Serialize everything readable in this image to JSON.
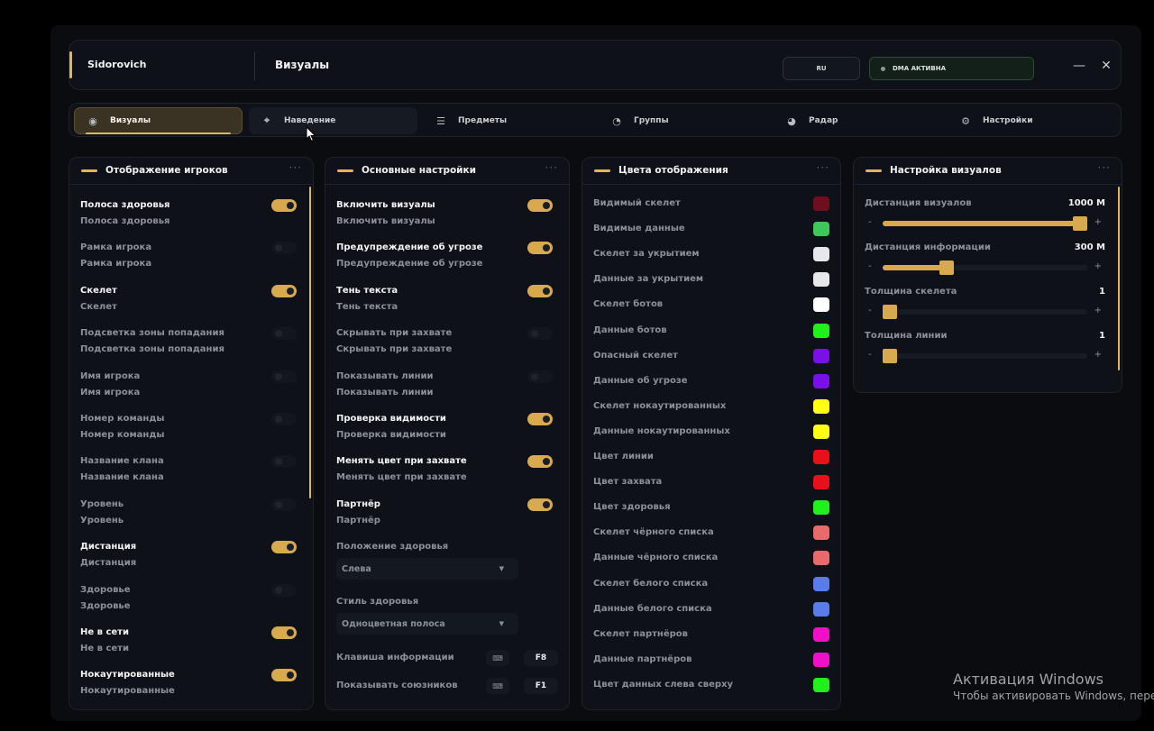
{
  "header": {
    "app_name": "Sidorovich",
    "page_title": "Визуалы",
    "lang": "RU",
    "dma_status": "DMA АКТИВНА",
    "minimize": "—",
    "close": "✕"
  },
  "tabs": [
    {
      "label": "Визуалы",
      "icon": "eye-icon",
      "glyph": "◉"
    },
    {
      "label": "Наведение",
      "icon": "crosshair-icon",
      "glyph": "⌖"
    },
    {
      "label": "Предметы",
      "icon": "sliders-icon",
      "glyph": "☰"
    },
    {
      "label": "Группы",
      "icon": "gauge-icon",
      "glyph": "◔"
    },
    {
      "label": "Радар",
      "icon": "radar-icon",
      "glyph": "◕"
    },
    {
      "label": "Настройки",
      "icon": "gear-icon",
      "glyph": "⚙"
    }
  ],
  "players_panel": {
    "title": "Отображение игроков",
    "more": "···",
    "items": [
      {
        "name": "Полоса здоровья",
        "sub": "Полоса здоровья",
        "on": true
      },
      {
        "name": "Рамка игрока",
        "sub": "Рамка игрока",
        "on": false
      },
      {
        "name": "Скелет",
        "sub": "Скелет",
        "on": true
      },
      {
        "name": "Подсветка зоны попадания",
        "sub": "Подсветка зоны попадания",
        "on": false
      },
      {
        "name": "Имя игрока",
        "sub": "Имя игрока",
        "on": false
      },
      {
        "name": "Номер команды",
        "sub": "Номер команды",
        "on": false
      },
      {
        "name": "Название клана",
        "sub": "Название клана",
        "on": false
      },
      {
        "name": "Уровень",
        "sub": "Уровень",
        "on": false
      },
      {
        "name": "Дистанция",
        "sub": "Дистанция",
        "on": true
      },
      {
        "name": "Здоровье",
        "sub": "Здоровье",
        "on": false
      },
      {
        "name": "Не в сети",
        "sub": "Не в сети",
        "on": true
      },
      {
        "name": "Нокаутированные",
        "sub": "Нокаутированные",
        "on": true
      }
    ]
  },
  "main_panel": {
    "title": "Основные настройки",
    "more": "···",
    "items": [
      {
        "name": "Включить визуалы",
        "sub": "Включить визуалы",
        "on": true
      },
      {
        "name": "Предупреждение об угрозе",
        "sub": "Предупреждение об угрозе",
        "on": true
      },
      {
        "name": "Тень текста",
        "sub": "Тень текста",
        "on": true
      },
      {
        "name": "Скрывать при захвате",
        "sub": "Скрывать при захвате",
        "on": false
      },
      {
        "name": "Показывать линии",
        "sub": "Показывать линии",
        "on": false
      },
      {
        "name": "Проверка видимости",
        "sub": "Проверка видимости",
        "on": true
      },
      {
        "name": "Менять цвет при захвате",
        "sub": "Менять цвет при захвате",
        "on": true
      },
      {
        "name": "Партнёр",
        "sub": "Партнёр",
        "on": true
      }
    ],
    "health_position_label": "Положение здоровья",
    "health_position_value": "Слева",
    "health_style_label": "Стиль здоровья",
    "health_style_value": "Одноцветная полоса",
    "info_key_label": "Клавиша информации",
    "info_key_value": "F8",
    "allies_key_label": "Показывать союзников",
    "allies_key_value": "F1",
    "keyboard_glyph": "⌨",
    "caret_glyph": "▼"
  },
  "colors_panel": {
    "title": "Цвета отображения",
    "more": "···",
    "items": [
      {
        "label": "Видимый скелет",
        "color": "#6e0e1e"
      },
      {
        "label": "Видимые данные",
        "color": "#3fc85a"
      },
      {
        "label": "Скелет за укрытием",
        "color": "#e6e7ea"
      },
      {
        "label": "Данные за укрытием",
        "color": "#e6e7ea"
      },
      {
        "label": "Скелет ботов",
        "color": "#ffffff"
      },
      {
        "label": "Данные ботов",
        "color": "#22f01c"
      },
      {
        "label": "Опасный скелет",
        "color": "#7a10e8"
      },
      {
        "label": "Данные об угрозе",
        "color": "#7a10e8"
      },
      {
        "label": "Скелет нокаутированных",
        "color": "#ffff14"
      },
      {
        "label": "Данные нокаутированных",
        "color": "#ffff14"
      },
      {
        "label": "Цвет линии",
        "color": "#e8101a"
      },
      {
        "label": "Цвет захвата",
        "color": "#e8101a"
      },
      {
        "label": "Цвет здоровья",
        "color": "#22f01c"
      },
      {
        "label": "Скелет чёрного списка",
        "color": "#e86a6a"
      },
      {
        "label": "Данные чёрного списка",
        "color": "#e86a6a"
      },
      {
        "label": "Скелет белого списка",
        "color": "#5a7ce8"
      },
      {
        "label": "Данные белого списка",
        "color": "#5a7ce8"
      },
      {
        "label": "Скелет партнёров",
        "color": "#f010c8"
      },
      {
        "label": "Данные партнёров",
        "color": "#f010c8"
      },
      {
        "label": "Цвет данных слева сверху",
        "color": "#22f01c"
      }
    ]
  },
  "visuals_panel": {
    "title": "Настройка визуалов",
    "more": "···",
    "sliders": [
      {
        "label": "Дистанция визуалов",
        "value": "1000 M",
        "fraction": 1.0
      },
      {
        "label": "Дистанция информации",
        "value": "300 M",
        "fraction": 0.3
      },
      {
        "label": "Толщина скелета",
        "value": "1",
        "fraction": 0.0
      },
      {
        "label": "Толщина линии",
        "value": "1",
        "fraction": 0.0
      }
    ],
    "minus": "-",
    "plus": "+"
  },
  "watermark": {
    "line1": "Активация Windows",
    "line2": "Чтобы активировать Windows, перейдите"
  },
  "colors": {
    "accent": "#e2b45c",
    "toggle_on": "#d9a94d"
  }
}
